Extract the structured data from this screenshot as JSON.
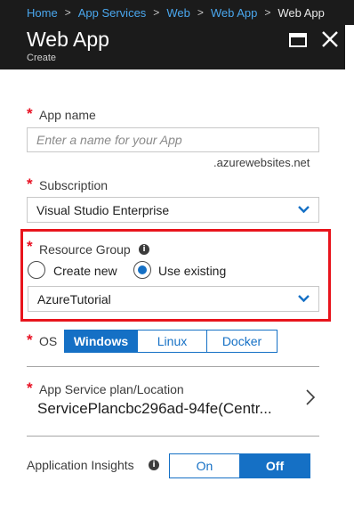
{
  "breadcrumb": {
    "items": [
      "Home",
      "App Services",
      "Web",
      "Web App"
    ],
    "current": "Web App",
    "separator": ">"
  },
  "header": {
    "title": "Web App",
    "subtitle": "Create",
    "maximize_icon": "maximize-icon",
    "close_icon": "close-icon"
  },
  "form": {
    "required_marker": "*",
    "app_name": {
      "label": "App name",
      "placeholder": "Enter a name for your App",
      "value": "",
      "suffix": ".azurewebsites.net"
    },
    "subscription": {
      "label": "Subscription",
      "selected": "Visual Studio Enterprise"
    },
    "resource_group": {
      "label": "Resource Group",
      "info_glyph": "i",
      "options": [
        "Create new",
        "Use existing"
      ],
      "selected_option": "Use existing",
      "selected": "AzureTutorial",
      "highlight_color": "#e8141c"
    },
    "os": {
      "label": "OS",
      "options": [
        "Windows",
        "Linux",
        "Docker"
      ],
      "selected": "Windows"
    },
    "app_service_plan": {
      "label": "App Service plan/Location",
      "value": "ServicePlancbc296ad-94fe(Centr..."
    },
    "application_insights": {
      "label": "Application Insights",
      "info_glyph": "i",
      "options": [
        "On",
        "Off"
      ],
      "selected": "Off"
    }
  },
  "colors": {
    "accent": "#1570c5",
    "link": "#4aa7ee",
    "header_bg": "#1b1b1b",
    "required": "#e81123"
  }
}
